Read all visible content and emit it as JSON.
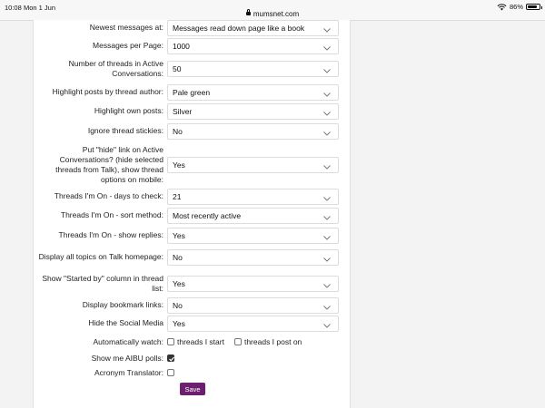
{
  "status_bar": {
    "time": "10:08",
    "date": "Mon 1 Jun",
    "url": "mumsnet.com",
    "battery": "86%",
    "battery_level": 0.86
  },
  "settings": [
    {
      "label": "Newest messages at:",
      "value": "Messages read down page like a book"
    },
    {
      "label": "Messages per Page:",
      "value": "1000"
    },
    {
      "label": "Number of threads in Active Conversations:",
      "value": "50"
    },
    {
      "label": "Highlight posts by thread author:",
      "value": "Pale green"
    },
    {
      "label": "Highlight own posts:",
      "value": "Silver"
    },
    {
      "label": "Ignore thread stickies:",
      "value": "No"
    },
    {
      "label": "Put \"hide\" link on Active Conversations? (hide selected threads from Talk), show thread options on mobile:",
      "value": "Yes"
    },
    {
      "label": "Threads I'm On - days to check:",
      "value": "21"
    },
    {
      "label": "Threads I'm On - sort method:",
      "value": "Most recently active"
    },
    {
      "label": "Threads I'm On - show replies:",
      "value": "Yes"
    },
    {
      "label": "Display all topics on Talk homepage:",
      "value": "No"
    },
    {
      "label": "Show \"Started by\" column in thread list:",
      "value": "Yes"
    },
    {
      "label": "Display bookmark links:",
      "value": "No"
    },
    {
      "label": "Hide the Social Media",
      "value": "Yes"
    }
  ],
  "auto_watch": {
    "label": "Automatically watch:",
    "option1": "threads I start",
    "option1_checked": false,
    "option2": "threads I post on",
    "option2_checked": false
  },
  "aibu": {
    "label": "Show me AIBU polls:",
    "checked": true
  },
  "acronym": {
    "label": "Acronym Translator:",
    "checked": false
  },
  "save_label": "Save"
}
